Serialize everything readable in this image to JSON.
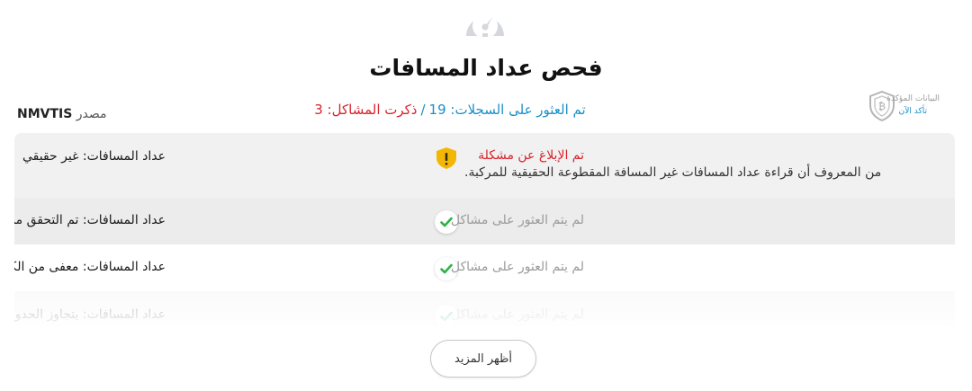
{
  "header": {
    "icon": "speedometer-icon",
    "title": "فحص عداد المسافات"
  },
  "summary": {
    "records_found": "تم العثور على السجلات: 19",
    "separator": "/",
    "issues_reported": "ذكرت المشاكل: 3"
  },
  "source": {
    "name": "NMVTIS",
    "label": "مصدر"
  },
  "verified_badge": {
    "icon": "shield-icon",
    "line1": "البيانات المؤكدة",
    "line2": "تأكد الآن"
  },
  "rows": [
    {
      "label": "عداد المسافات: غير حقيقي",
      "status": "تم الإبلاغ عن مشكلة",
      "status_type": "problem",
      "icon": "warning-icon",
      "description": ".من المعروف أن قراءة عداد المسافات غير المسافة المقطوعة الحقيقية للمركبة"
    },
    {
      "label": "عداد المسافات: تم التحقق من العبث",
      "status": "لم يتم العثور على مشاكل",
      "status_type": "ok",
      "icon": "check-icon"
    },
    {
      "label": "عداد المسافات: معفى من الكشف عن عداد المسافات",
      "status": "لم يتم العثور على مشاكل",
      "status_type": "ok",
      "icon": "check-icon"
    },
    {
      "label": "عداد المسافات: يتجاوز الحدود الميكانيكية",
      "status": "لم يتم العثور على مشاكل",
      "status_type": "ok",
      "icon": "check-icon"
    }
  ],
  "show_more_label": "أظهر المزيد",
  "colors": {
    "accent_blue": "#1a8fc9",
    "problem_red": "#d9232d",
    "warning_yellow": "#f2b705",
    "check_green": "#2fb344"
  }
}
